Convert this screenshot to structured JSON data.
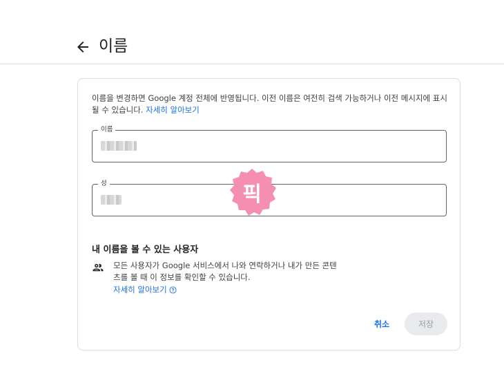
{
  "header": {
    "title": "이름"
  },
  "description": {
    "text": "이름을 변경하면 Google 계정 전체에 반영됩니다. 이전 이름은 여전히 검색 가능하거나 이전 메시지에 표시될 수 있습니다. ",
    "link": "자세히 알아보기"
  },
  "fields": {
    "first_name": {
      "label": "이름"
    },
    "last_name": {
      "label": "성"
    }
  },
  "visibility": {
    "title": "내 이름을 볼 수 있는 사용자",
    "text": "모든 사용자가 Google 서비스에서 나와 연락하거나 내가 만든 콘텐츠를 볼 때 이 정보를 확인할 수 있습니다.",
    "link": "자세히 알아보기"
  },
  "actions": {
    "cancel": "취소",
    "save": "저장"
  },
  "watermark": {
    "text": "픽"
  },
  "colors": {
    "accent": "#1a73e8",
    "watermark": "#f48fb1"
  }
}
